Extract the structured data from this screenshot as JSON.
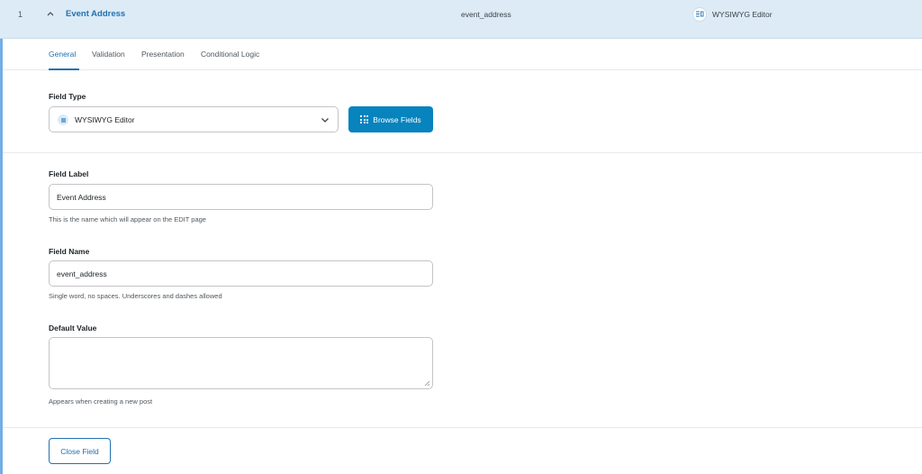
{
  "header": {
    "order": "1",
    "label": "Event Address",
    "name": "event_address",
    "type": "WYSIWYG Editor",
    "type_icon": "wysiwyg-icon",
    "collapse_icon": "chevron-up-icon"
  },
  "tabs": [
    {
      "label": "General",
      "active": true
    },
    {
      "label": "Validation",
      "active": false
    },
    {
      "label": "Presentation",
      "active": false
    },
    {
      "label": "Conditional Logic",
      "active": false
    }
  ],
  "field_type": {
    "label": "Field Type",
    "value": "WYSIWYG Editor",
    "browse_label": "Browse Fields"
  },
  "field_label": {
    "label": "Field Label",
    "value": "Event Address",
    "description": "This is the name which will appear on the EDIT page"
  },
  "field_name": {
    "label": "Field Name",
    "value": "event_address",
    "description": "Single word, no spaces. Underscores and dashes allowed"
  },
  "default_value": {
    "label": "Default Value",
    "value": "",
    "description": "Appears when creating a new post"
  },
  "footer": {
    "close_label": "Close Field"
  },
  "colors": {
    "accent": "#2271b1",
    "header_bg": "#dcebf5",
    "button_bg": "#0783be"
  }
}
